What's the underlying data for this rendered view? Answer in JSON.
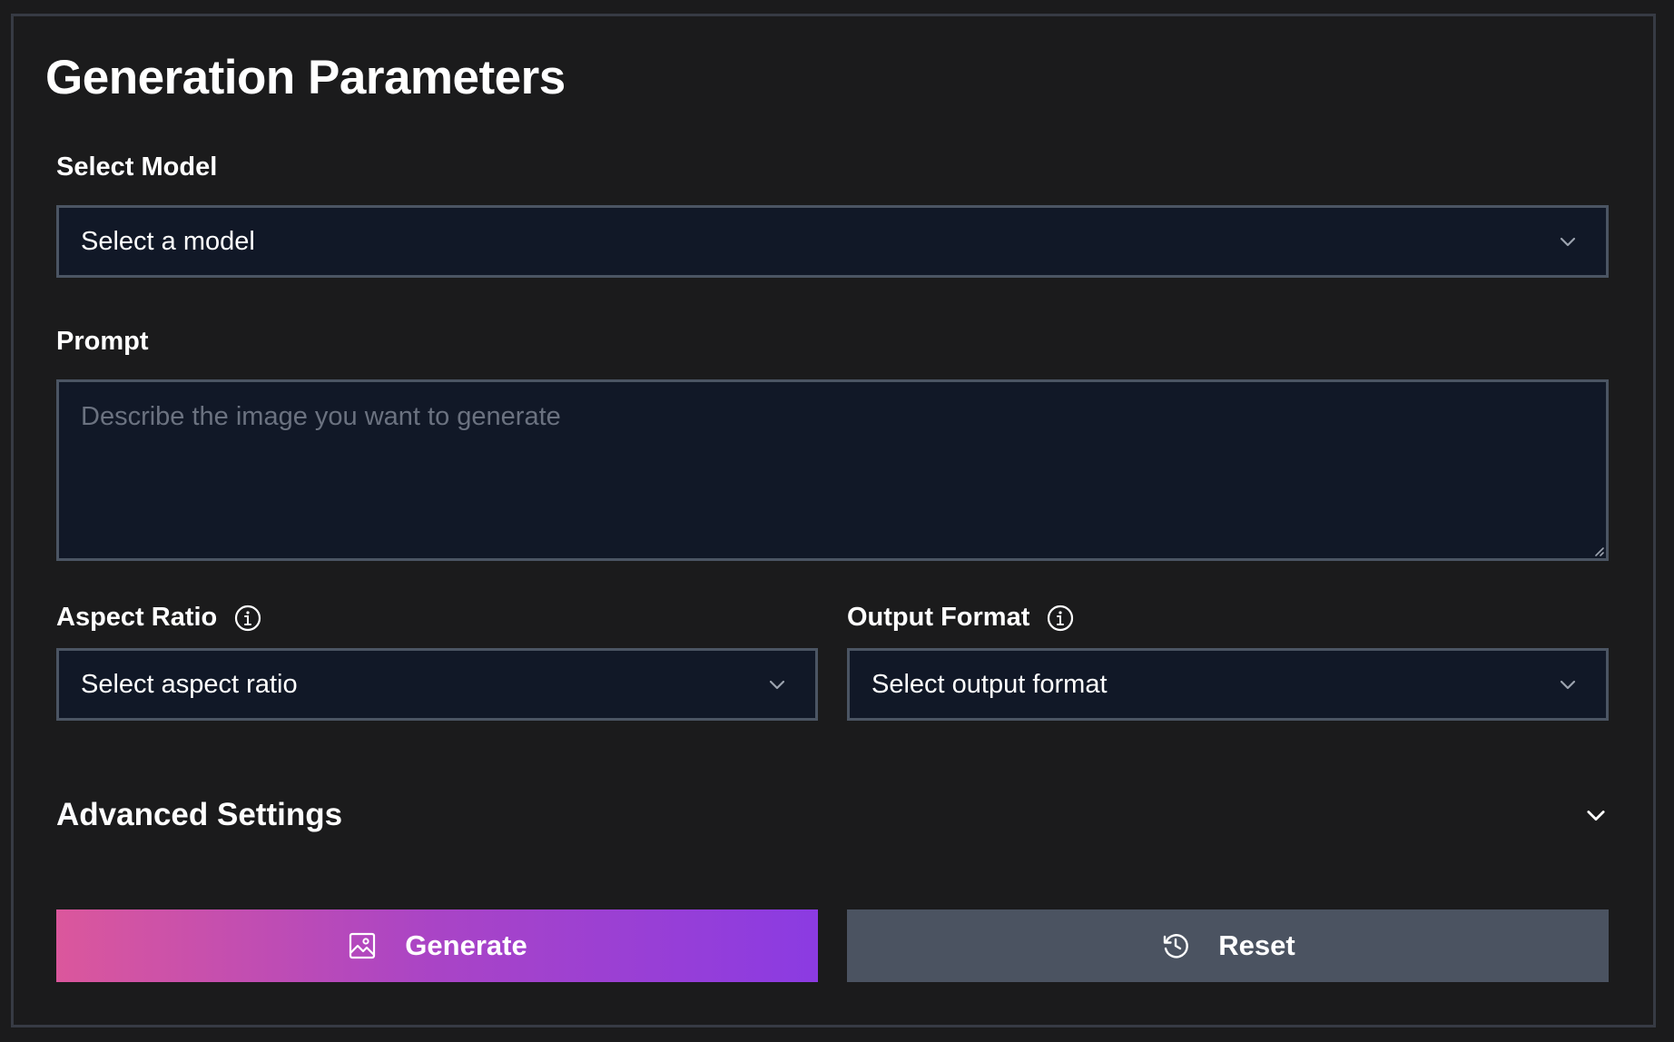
{
  "panel": {
    "title": "Generation Parameters"
  },
  "model": {
    "label": "Select Model",
    "value": "Select a model",
    "icon": "chevron-down-icon"
  },
  "prompt": {
    "label": "Prompt",
    "placeholder": "Describe the image you want to generate",
    "value": ""
  },
  "aspect_ratio": {
    "label": "Aspect Ratio",
    "info_icon": "info-icon",
    "value": "Select aspect ratio",
    "icon": "chevron-down-icon"
  },
  "output_format": {
    "label": "Output Format",
    "info_icon": "info-icon",
    "value": "Select output format",
    "icon": "chevron-down-icon"
  },
  "advanced": {
    "label": "Advanced Settings",
    "icon": "chevron-down-icon"
  },
  "actions": {
    "generate_label": "Generate",
    "generate_icon": "image-icon",
    "reset_label": "Reset",
    "reset_icon": "history-icon"
  },
  "colors": {
    "background": "#1b1b1c",
    "field_bg": "#111827",
    "field_border": "#4b5563",
    "generate_gradient_start": "#db579c",
    "generate_gradient_end": "#8b3be2",
    "reset_bg": "#4b5361"
  }
}
